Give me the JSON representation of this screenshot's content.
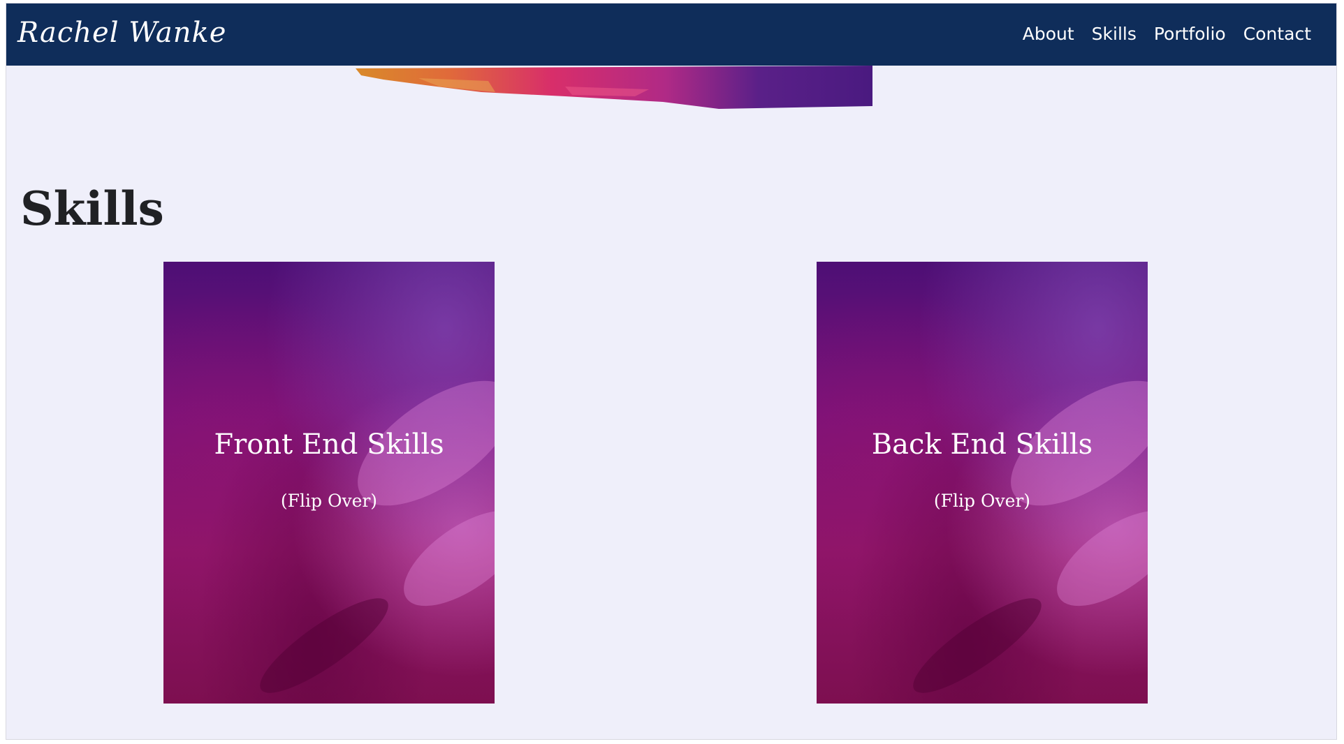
{
  "navbar": {
    "brand": "Rachel Wanke",
    "links": [
      "About",
      "Skills",
      "Portfolio",
      "Contact"
    ]
  },
  "skills": {
    "title": "Skills",
    "cards": [
      {
        "title": "Front End Skills",
        "subtitle": "(Flip Over)"
      },
      {
        "title": "Back End Skills",
        "subtitle": "(Flip Over)"
      }
    ]
  },
  "colors": {
    "navbar_bg": "#0f2d5a",
    "page_bg": "#efeffa",
    "card_primary": "#7a127a"
  }
}
